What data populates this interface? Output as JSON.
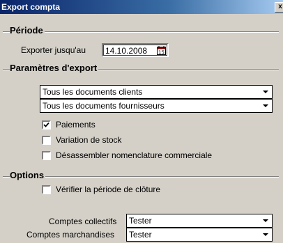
{
  "window": {
    "title": "Export compta",
    "close_glyph": "x"
  },
  "periode": {
    "heading": "Période",
    "export_label": "Exporter jusqu'au",
    "date_value": "14.10.2008",
    "calendar_icon": "calendar-icon"
  },
  "parametres": {
    "heading": "Paramètres d'export",
    "clients_select": "Tous les documents clients",
    "fournisseurs_select": "Tous les documents fournisseurs",
    "checks": [
      {
        "label": "Paiements",
        "checked": true
      },
      {
        "label": "Variation de stock",
        "checked": false
      },
      {
        "label": "Désassembler nomenclature commerciale",
        "checked": false
      }
    ]
  },
  "options": {
    "heading": "Options",
    "verifier_label": "Vérifier la période de clôture",
    "verifier_checked": false,
    "comptes_collectifs_label": "Comptes collectifs",
    "comptes_collectifs_value": "Tester",
    "comptes_marchandises_label": "Comptes marchandises",
    "comptes_marchandises_value": "Tester"
  },
  "colors": {
    "face": "#d4d0c8",
    "title_start": "#0a246a",
    "title_end": "#a6caf0"
  }
}
